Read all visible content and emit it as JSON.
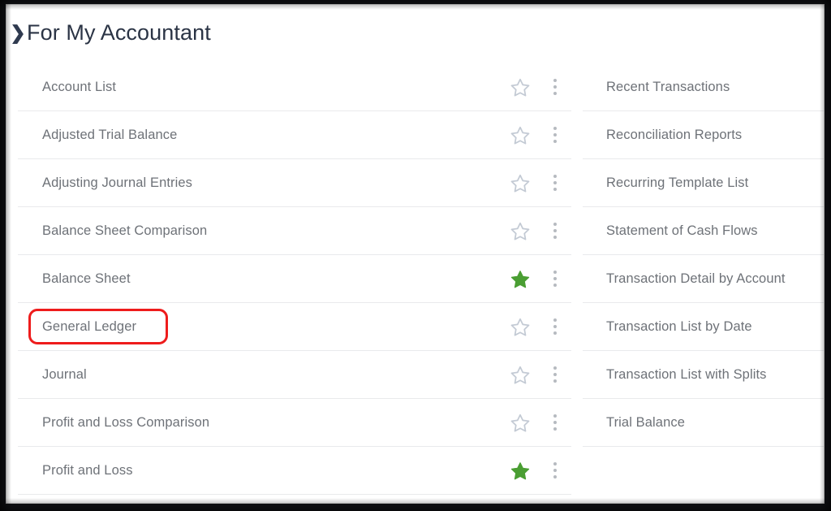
{
  "header": {
    "chevron_icon": "chevron-right-icon",
    "title": "For My Accountant"
  },
  "icons": {
    "star_off": "star-outline-icon",
    "star_on": "star-filled-icon",
    "kebab": "more-options-icon"
  },
  "colors": {
    "highlight": "#ee1c1c",
    "favorite_star": "#4a9e33",
    "star_outline": "#c3cad4",
    "row_divider": "#e9eaec",
    "row_text": "#6e7278",
    "title_text": "#2b3445",
    "kebab_dot": "#b6bac0",
    "page_background": "#ffffff"
  },
  "columns": {
    "left": {
      "rows": [
        {
          "label": "Account List",
          "favorite": false,
          "highlighted": false
        },
        {
          "label": "Adjusted Trial Balance",
          "favorite": false,
          "highlighted": false
        },
        {
          "label": "Adjusting Journal Entries",
          "favorite": false,
          "highlighted": false
        },
        {
          "label": "Balance Sheet Comparison",
          "favorite": false,
          "highlighted": false
        },
        {
          "label": "Balance Sheet",
          "favorite": true,
          "highlighted": false
        },
        {
          "label": "General Ledger",
          "favorite": false,
          "highlighted": true
        },
        {
          "label": "Journal",
          "favorite": false,
          "highlighted": false
        },
        {
          "label": "Profit and Loss Comparison",
          "favorite": false,
          "highlighted": false
        },
        {
          "label": "Profit and Loss",
          "favorite": true,
          "highlighted": false
        }
      ]
    },
    "right": {
      "rows": [
        {
          "label": "Recent Transactions"
        },
        {
          "label": "Reconciliation Reports"
        },
        {
          "label": "Recurring Template List"
        },
        {
          "label": "Statement of Cash Flows"
        },
        {
          "label": "Transaction Detail by Account"
        },
        {
          "label": "Transaction List by Date"
        },
        {
          "label": "Transaction List with Splits"
        },
        {
          "label": "Trial Balance"
        }
      ]
    }
  }
}
